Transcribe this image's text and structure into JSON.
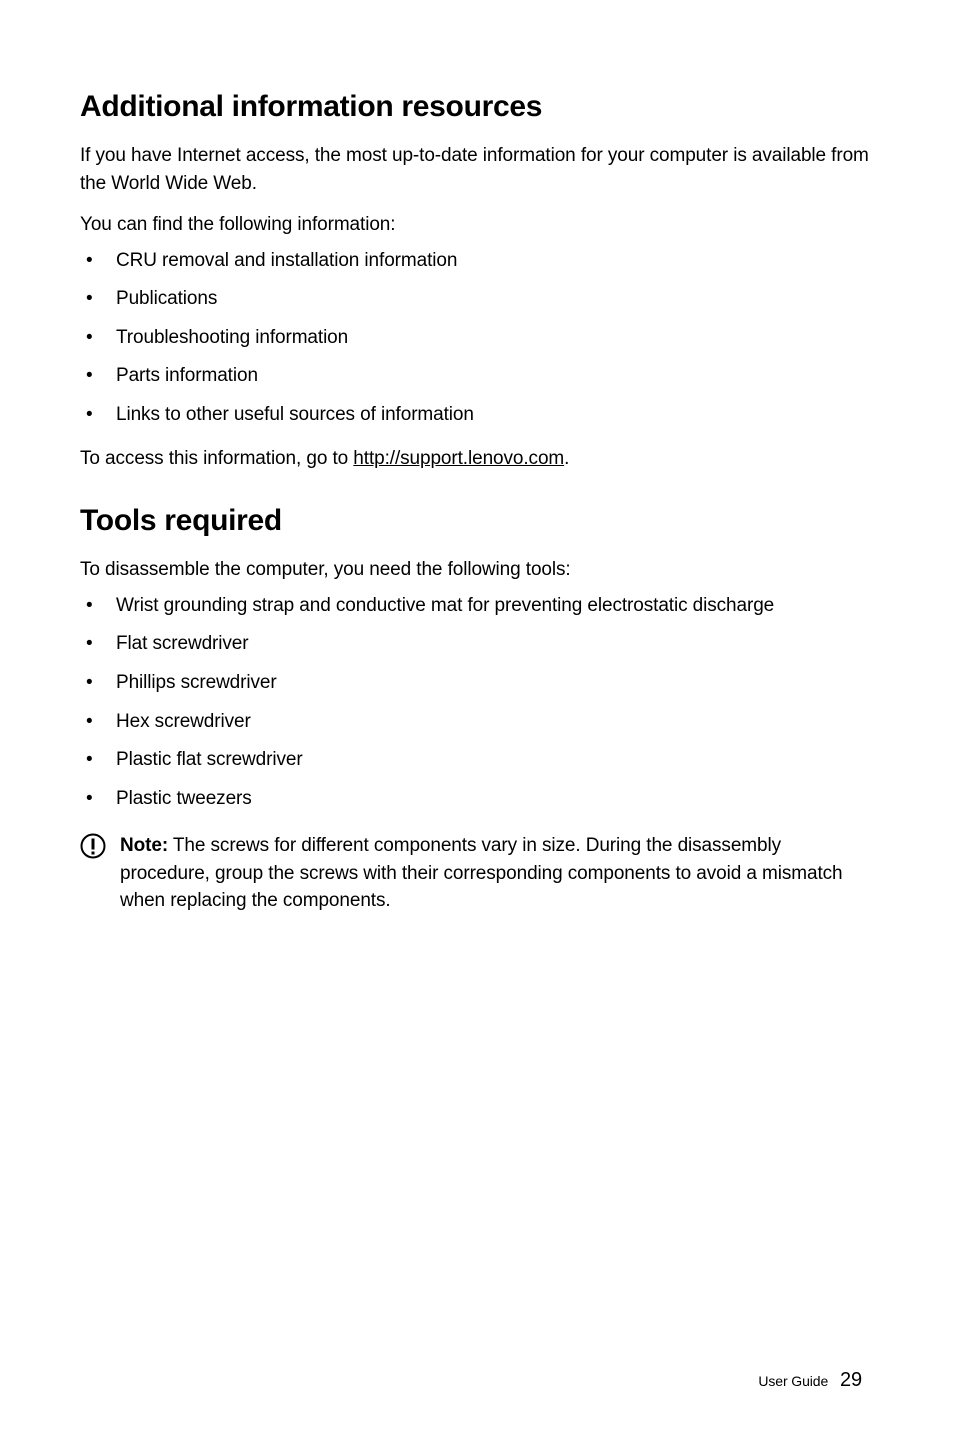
{
  "section1": {
    "heading": "Additional information resources",
    "para1": "If you have Internet access, the most up-to-date information for your computer is available from the World Wide Web.",
    "para2": "You can find the following information:",
    "items": [
      "CRU removal and installation information",
      "Publications",
      "Troubleshooting information",
      "Parts information",
      "Links to other useful sources of information"
    ],
    "access_prefix": "To access this information, go to ",
    "access_link": "http://support.lenovo.com",
    "access_suffix": "."
  },
  "section2": {
    "heading": "Tools required",
    "para1": "To disassemble the computer, you need the following tools:",
    "items": [
      "Wrist grounding strap and conductive mat for preventing electrostatic discharge",
      "Flat screwdriver",
      "Phillips screwdriver",
      "Hex screwdriver",
      "Plastic flat screwdriver",
      "Plastic tweezers"
    ],
    "note_label": "Note:",
    "note_text": " The screws for different components vary in size. During the disassembly procedure, group the screws with their corresponding components to avoid a mismatch when replacing the components."
  },
  "footer": {
    "label": "User Guide",
    "page": "29"
  }
}
